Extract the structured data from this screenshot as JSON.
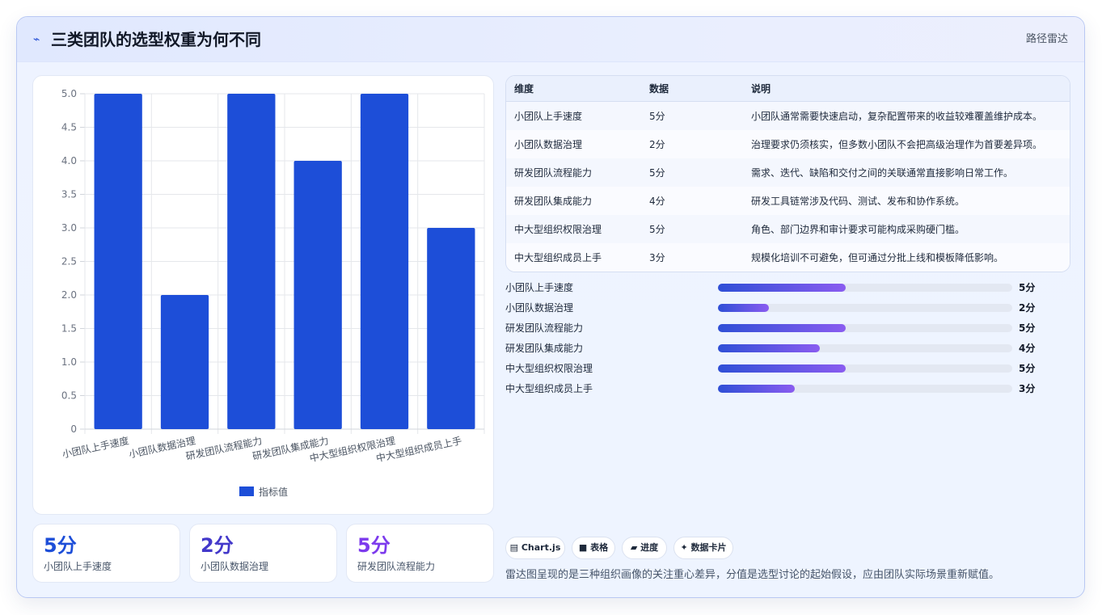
{
  "header": {
    "icon": "pulse-icon",
    "title": "三类团队的选型权重为何不同",
    "tag": "路径雷达"
  },
  "chart_data": {
    "type": "bar",
    "categories": [
      "小团队上手速度",
      "小团队数据治理",
      "研发团队流程能力",
      "研发团队集成能力",
      "中大型组织权限治理",
      "中大型组织成员上手"
    ],
    "series": [
      {
        "name": "指标值",
        "values": [
          5,
          2,
          5,
          4,
          5,
          3
        ]
      }
    ],
    "ylim": [
      0,
      5
    ],
    "yticks": [
      "0",
      "0.5",
      "1.0",
      "1.5",
      "2.0",
      "2.5",
      "3.0",
      "3.5",
      "4.0",
      "4.5",
      "5.0"
    ],
    "grid": true,
    "legend": "bottom",
    "color": "#1d4ed8"
  },
  "stats": [
    {
      "value": "5分",
      "label": "小团队上手速度",
      "color": "#1d4ed8"
    },
    {
      "value": "2分",
      "label": "小团队数据治理",
      "color": "#4338ca"
    },
    {
      "value": "5分",
      "label": "研发团队流程能力",
      "color": "#7c3aed"
    }
  ],
  "table": {
    "headers": [
      "维度",
      "数据",
      "说明"
    ],
    "rows": [
      [
        "小团队上手速度",
        "5分",
        "小团队通常需要快速启动，复杂配置带来的收益较难覆盖维护成本。"
      ],
      [
        "小团队数据治理",
        "2分",
        "治理要求仍须核实，但多数小团队不会把高级治理作为首要差异项。"
      ],
      [
        "研发团队流程能力",
        "5分",
        "需求、迭代、缺陷和交付之间的关联通常直接影响日常工作。"
      ],
      [
        "研发团队集成能力",
        "4分",
        "研发工具链常涉及代码、测试、发布和协作系统。"
      ],
      [
        "中大型组织权限治理",
        "5分",
        "角色、部门边界和审计要求可能构成采购硬门槛。"
      ],
      [
        "中大型组织成员上手",
        "3分",
        "规模化培训不可避免，但可通过分批上线和模板降低影响。"
      ]
    ]
  },
  "progress": [
    {
      "label": "小团队上手速度",
      "value": "5分",
      "fraction": 0.4333
    },
    {
      "label": "小团队数据治理",
      "value": "2分",
      "fraction": 0.1733
    },
    {
      "label": "研发团队流程能力",
      "value": "5分",
      "fraction": 0.4333
    },
    {
      "label": "研发团队集成能力",
      "value": "4分",
      "fraction": 0.3467
    },
    {
      "label": "中大型组织权限治理",
      "value": "5分",
      "fraction": 0.4333
    },
    {
      "label": "中大型组织成员上手",
      "value": "3分",
      "fraction": 0.26
    }
  ],
  "chips": [
    {
      "icon": "chart-icon",
      "glyph": "▤",
      "label": "Chart.js"
    },
    {
      "icon": "table-icon",
      "glyph": "■",
      "label": "表格"
    },
    {
      "icon": "progress-icon",
      "glyph": "▰",
      "label": "进度"
    },
    {
      "icon": "sparkle-icon",
      "glyph": "✦",
      "label": "数据卡片"
    }
  ],
  "footnote": "雷达图呈现的是三种组织画像的关注重心差异，分值是选型讨论的起始假设，应由团队实际场景重新赋值。"
}
